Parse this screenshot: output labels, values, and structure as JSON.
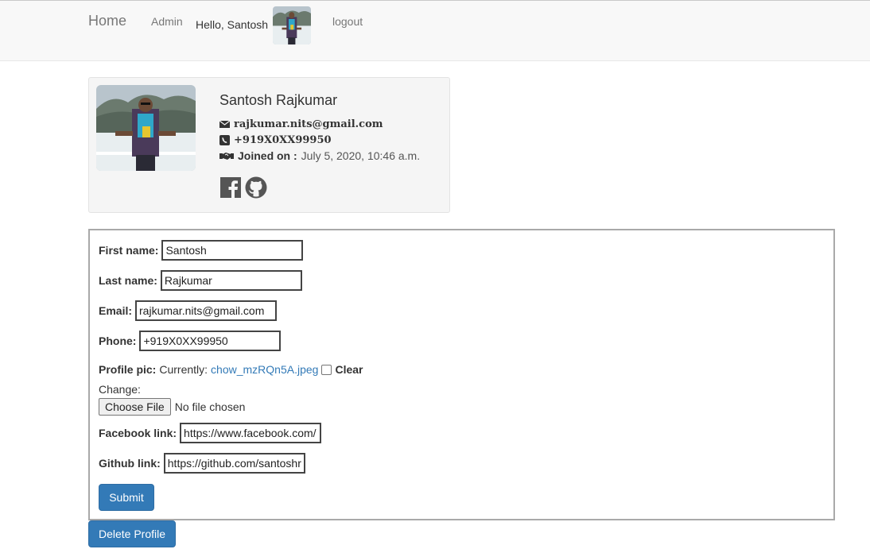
{
  "navbar": {
    "brand": "Home",
    "admin": "Admin",
    "greeting": "Hello, Santosh",
    "logout": "logout"
  },
  "profile": {
    "name": "Santosh Rajkumar",
    "email": "rajkumar.nits@gmail.com",
    "phone": "+919X0XX99950",
    "joined_label": "Joined on :",
    "joined_value": "July 5, 2020, 10:46 a.m.",
    "icons": [
      "envelope-icon",
      "phone-icon",
      "handshake-icon",
      "facebook-icon",
      "github-icon"
    ]
  },
  "form": {
    "first_name_label": "First name:",
    "first_name_value": "Santosh",
    "last_name_label": "Last name:",
    "last_name_value": "Rajkumar",
    "email_label": "Email:",
    "email_value": "rajkumar.nits@gmail.com",
    "phone_label": "Phone:",
    "phone_value": "+919X0XX99950",
    "profile_pic_label": "Profile pic:",
    "currently_text": "Currently:",
    "current_file": "chow_mzRQn5A.jpeg",
    "clear_label": "Clear",
    "change_label": "Change:",
    "choose_file_label": "Choose File",
    "no_file_text": "No file chosen",
    "facebook_label": "Facebook link:",
    "facebook_value": "https://www.facebook.com/",
    "github_label": "Github link:",
    "github_value": "https://github.com/santoshrajkumar",
    "submit_label": "Submit"
  },
  "delete_label": "Delete Profile",
  "colors": {
    "primary": "#337ab7",
    "navbar_bg": "#f8f8f8",
    "card_bg": "#f5f5f5"
  }
}
